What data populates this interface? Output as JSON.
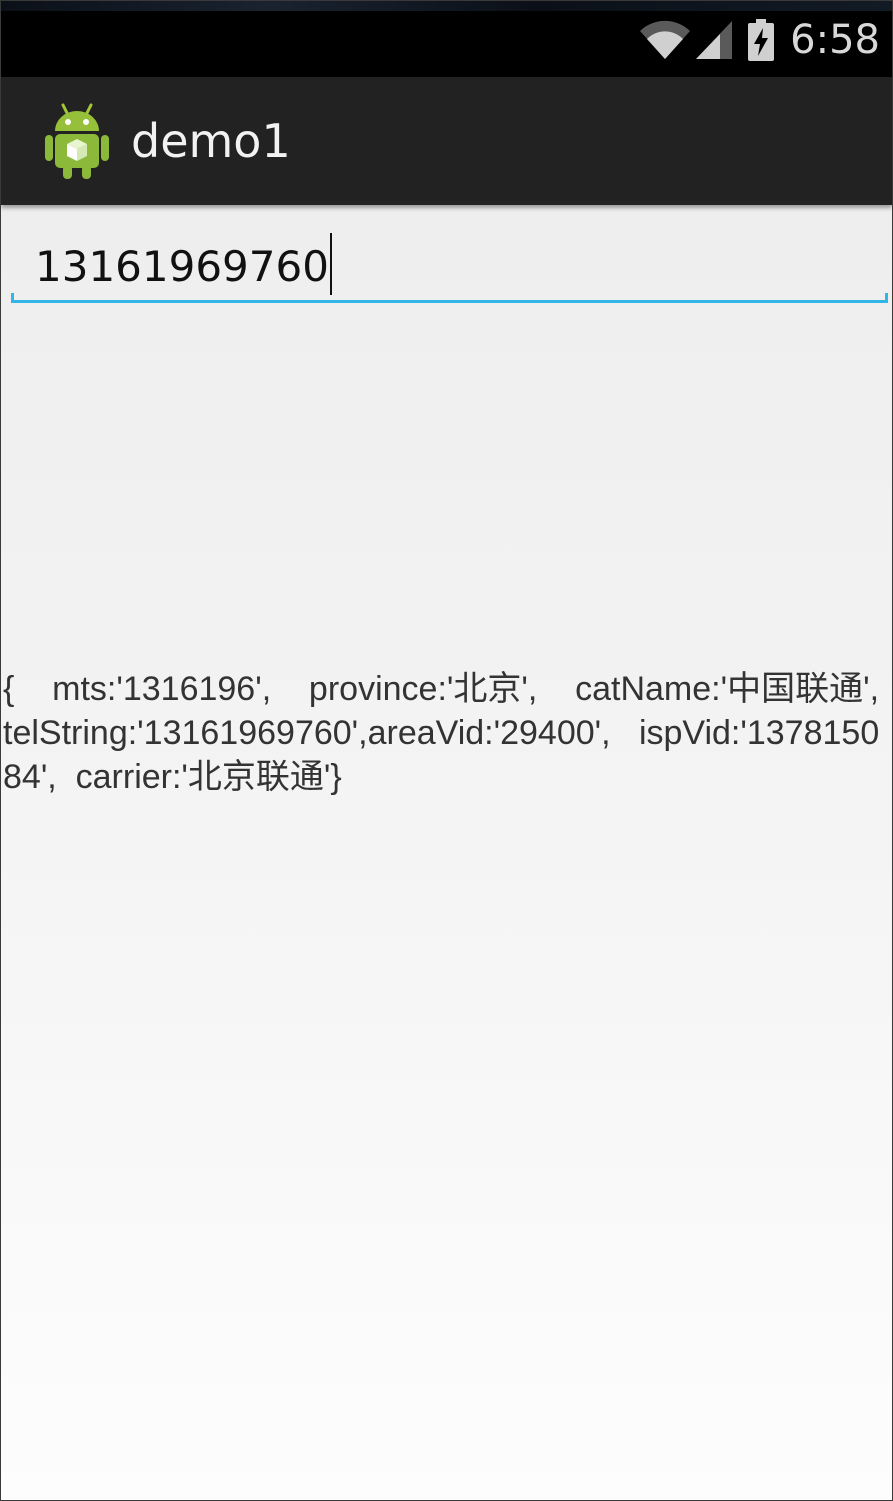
{
  "status_bar": {
    "time": "6:58",
    "icons": [
      "wifi-icon",
      "signal-icon",
      "battery-charging-icon"
    ]
  },
  "action_bar": {
    "app_icon": "android-robot-icon",
    "title": "demo1"
  },
  "phone_input": {
    "value": "13161969760",
    "accent_color": "#33b5e5"
  },
  "result": {
    "text": "{    mts:'1316196',    province:'北京',    catName:'中国联通',    telString:'13161969760',areaVid:'29400',   ispVid:'137815084',  carrier:'北京联通'}"
  }
}
